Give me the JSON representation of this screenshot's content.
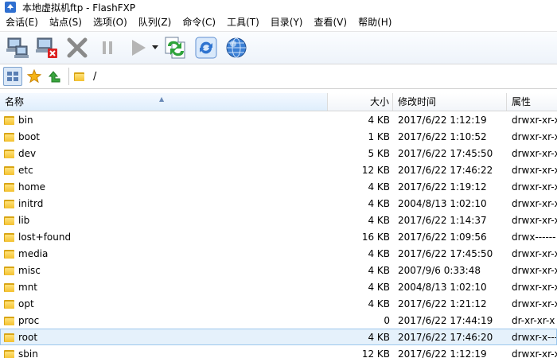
{
  "window": {
    "title": "本地虚拟机ftp - FlashFXP"
  },
  "menu": [
    "会话(E)",
    "站点(S)",
    "选项(O)",
    "队列(Z)",
    "命令(C)",
    "工具(T)",
    "目录(Y)",
    "查看(V)",
    "帮助(H)"
  ],
  "toolbar": {
    "icons": [
      "connect-icon",
      "disconnect-icon",
      "abort-icon",
      "pause-icon",
      "play-icon",
      "dropdown-arrow-icon",
      "transfer-icon",
      "refresh-icon",
      "globe-icon"
    ]
  },
  "address": {
    "path": "/"
  },
  "columns": {
    "name": "名称",
    "size": "大小",
    "time": "修改时间",
    "attr": "属性"
  },
  "files": [
    {
      "name": "bin",
      "size": "4 KB",
      "time": "2017/6/22 1:12:19",
      "attr": "drwxr-xr-x"
    },
    {
      "name": "boot",
      "size": "1 KB",
      "time": "2017/6/22 1:10:52",
      "attr": "drwxr-xr-x"
    },
    {
      "name": "dev",
      "size": "5 KB",
      "time": "2017/6/22 17:45:50",
      "attr": "drwxr-xr-x"
    },
    {
      "name": "etc",
      "size": "12 KB",
      "time": "2017/6/22 17:46:22",
      "attr": "drwxr-xr-x"
    },
    {
      "name": "home",
      "size": "4 KB",
      "time": "2017/6/22 1:19:12",
      "attr": "drwxr-xr-x"
    },
    {
      "name": "initrd",
      "size": "4 KB",
      "time": "2004/8/13 1:02:10",
      "attr": "drwxr-xr-x"
    },
    {
      "name": "lib",
      "size": "4 KB",
      "time": "2017/6/22 1:14:37",
      "attr": "drwxr-xr-x"
    },
    {
      "name": "lost+found",
      "size": "16 KB",
      "time": "2017/6/22 1:09:56",
      "attr": "drwx------"
    },
    {
      "name": "media",
      "size": "4 KB",
      "time": "2017/6/22 17:45:50",
      "attr": "drwxr-xr-x"
    },
    {
      "name": "misc",
      "size": "4 KB",
      "time": "2007/9/6 0:33:48",
      "attr": "drwxr-xr-x"
    },
    {
      "name": "mnt",
      "size": "4 KB",
      "time": "2004/8/13 1:02:10",
      "attr": "drwxr-xr-x"
    },
    {
      "name": "opt",
      "size": "4 KB",
      "time": "2017/6/22 1:21:12",
      "attr": "drwxr-xr-x"
    },
    {
      "name": "proc",
      "size": "0",
      "time": "2017/6/22 17:44:19",
      "attr": "dr-xr-xr-x"
    },
    {
      "name": "root",
      "size": "4 KB",
      "time": "2017/6/22 17:46:20",
      "attr": "drwxr-x---",
      "selected": true
    },
    {
      "name": "sbin",
      "size": "12 KB",
      "time": "2017/6/22 1:12:19",
      "attr": "drwxr-xr-x"
    }
  ]
}
